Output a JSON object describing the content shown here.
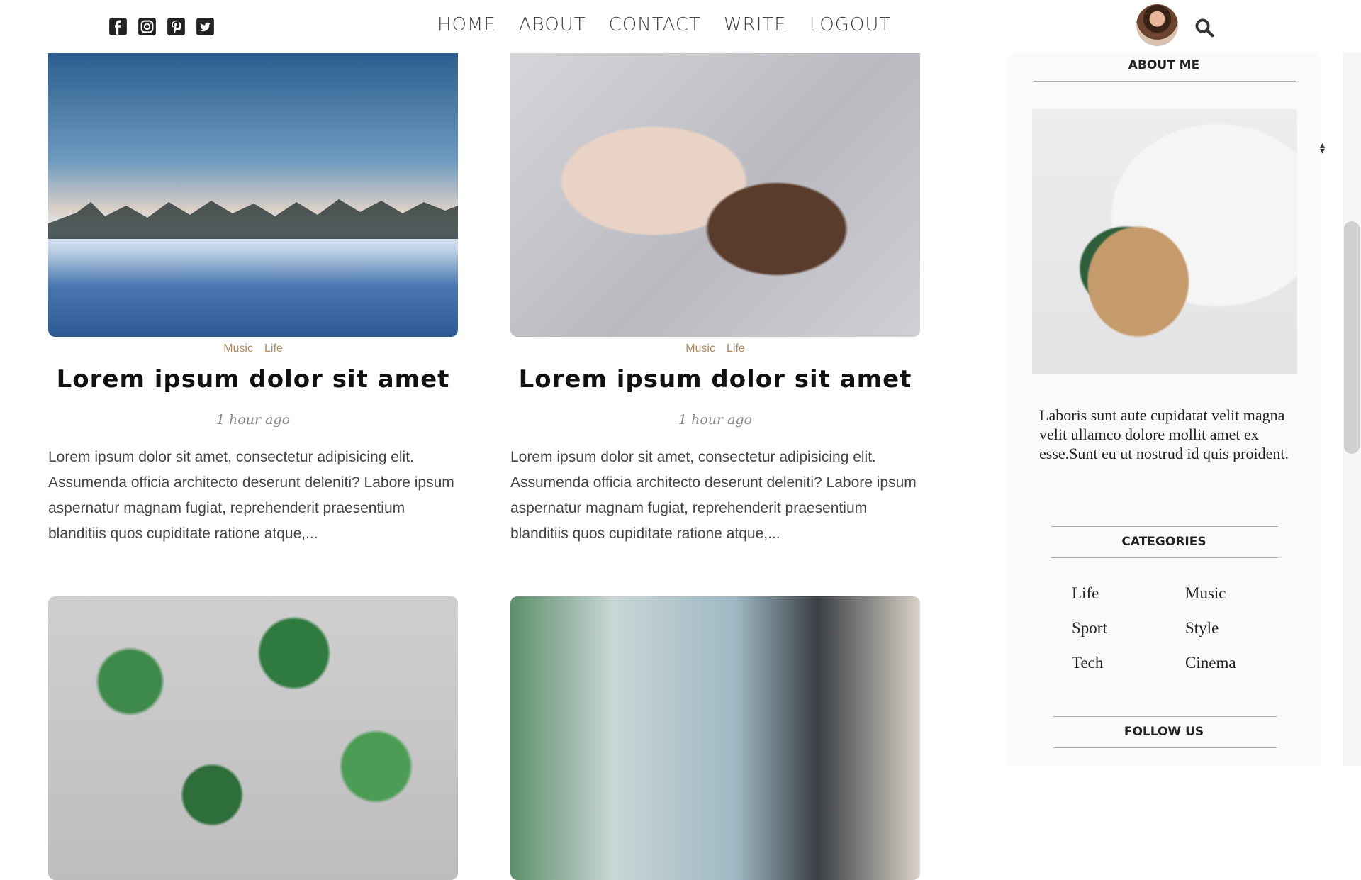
{
  "nav": {
    "items": [
      "HOME",
      "ABOUT",
      "CONTACT",
      "WRITE",
      "LOGOUT"
    ]
  },
  "social": [
    "facebook-icon",
    "instagram-icon",
    "pinterest-icon",
    "twitter-icon"
  ],
  "posts": [
    {
      "image": "snowy-landscape",
      "categories": [
        "Music",
        "Life"
      ],
      "title": "Lorem ipsum dolor sit amet",
      "date": "1 hour ago",
      "desc": "Lorem ipsum dolor sit amet, consectetur adipisicing elit. Assumenda officia architecto deserunt deleniti? Labore ipsum aspernatur magnam fugiat, reprehenderit praesentium blanditiis quos cupiditate ratione atque,..."
    },
    {
      "image": "woman-lying",
      "categories": [
        "Music",
        "Life"
      ],
      "title": "Lorem ipsum dolor sit amet",
      "date": "1 hour ago",
      "desc": "Lorem ipsum dolor sit amet, consectetur adipisicing elit. Assumenda officia architecto deserunt deleniti? Labore ipsum aspernatur magnam fugiat, reprehenderit praesentium blanditiis quos cupiditate ratione atque,..."
    },
    {
      "image": "ivy-leaves"
    },
    {
      "image": "spa-items"
    }
  ],
  "sidebar": {
    "about_title": "ABOUT ME",
    "about_text": "Laboris sunt aute cupidatat velit magna velit ullamco dolore mollit amet ex esse.Sunt eu ut nostrud id quis proident.",
    "categories_title": "CATEGORIES",
    "categories": [
      "Life",
      "Music",
      "Sport",
      "Style",
      "Tech",
      "Cinema"
    ],
    "follow_title": "FOLLOW US"
  }
}
